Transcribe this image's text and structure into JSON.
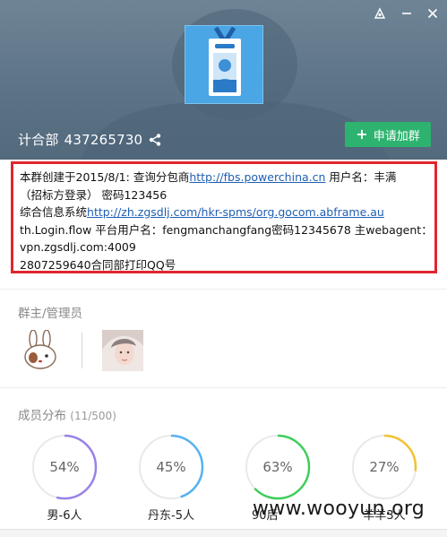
{
  "header": {
    "group_name": "计合部",
    "group_id": "437265730",
    "join_button": "申请加群"
  },
  "notice": {
    "line1_prefix": "本群创建于2015/8/1:  查询分包商",
    "line1_link": "http://fbs.powerchina.cn",
    "line1_suffix": "   用户名：丰满",
    "line2": "（招标方登录）  密码123456",
    "line3_prefix": "综合信息系统",
    "line3_link": "http://zh.zgsdlj.com/hkr-spms/org.gocom.abframe.au",
    "line4": "th.Login.flow 平台用户名：fengmanchangfang密码12345678   主webagent：",
    "line5": "vpn.zgsdlj.com:4009",
    "line6": "2807259640合同部打印QQ号"
  },
  "admins": {
    "title": "群主/管理员"
  },
  "members": {
    "title": "成员分布",
    "count": "(11/500)",
    "stats": [
      {
        "percent": "54%",
        "label": "男-6人",
        "value": 0.54,
        "color": "#9a82e6"
      },
      {
        "percent": "45%",
        "label": "丹东-5人",
        "value": 0.45,
        "color": "#55b3ee"
      },
      {
        "percent": "63%",
        "label": "90后",
        "value": 0.63,
        "color": "#3fce5c"
      },
      {
        "percent": "27%",
        "label": "羊羊3人",
        "value": 0.27,
        "color": "#f1c232"
      }
    ]
  },
  "watermark": "www.wooyun.org",
  "colors": {
    "header_bg": "#5d7487",
    "join_button": "#2db36f",
    "notice_border": "#e0262e",
    "link": "#1f5fb4"
  }
}
